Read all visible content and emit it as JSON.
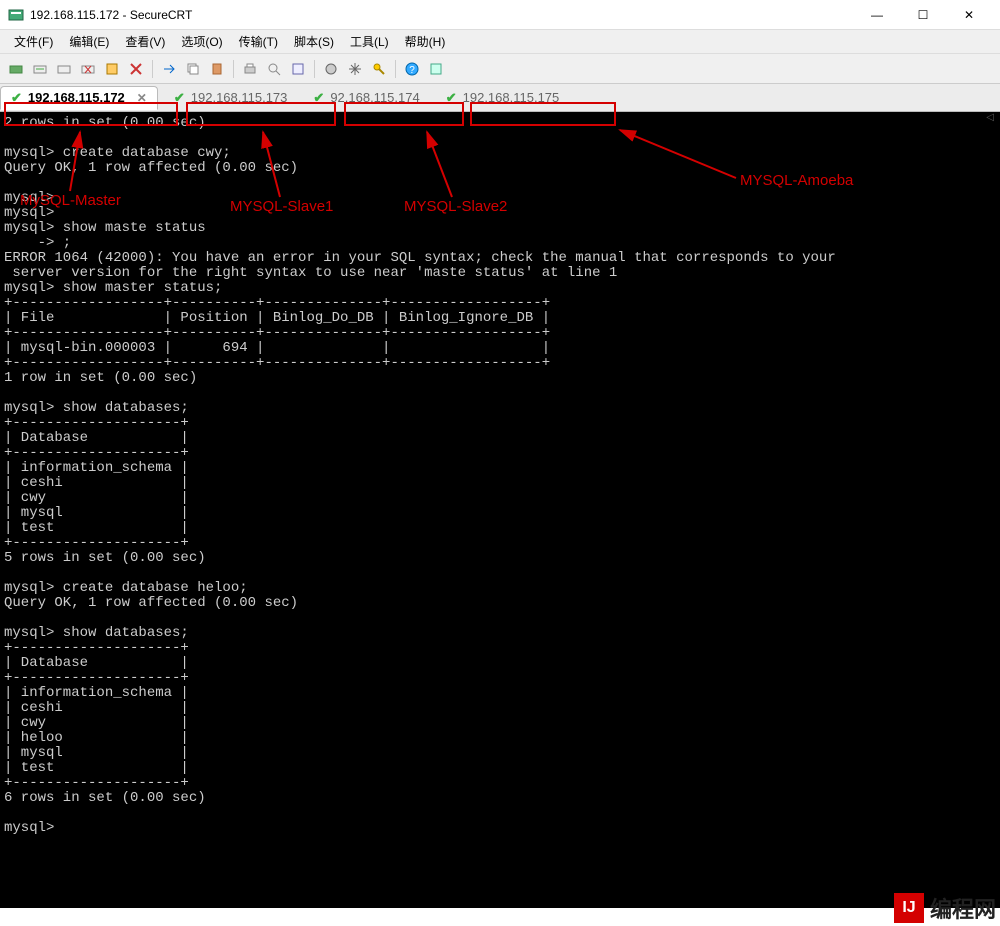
{
  "window": {
    "title": "192.168.115.172 - SecureCRT"
  },
  "menu": {
    "items": [
      "文件(F)",
      "编辑(E)",
      "查看(V)",
      "选项(O)",
      "传输(T)",
      "脚本(S)",
      "工具(L)",
      "帮助(H)"
    ]
  },
  "tabs": [
    {
      "label": "192.168.115.172",
      "active": true,
      "closeable": true
    },
    {
      "label": "192.168.115.173",
      "active": false,
      "closeable": false
    },
    {
      "label": "92.168.115.174",
      "active": false,
      "closeable": false
    },
    {
      "label": "192.168.115.175",
      "active": false,
      "closeable": false
    }
  ],
  "annotations": {
    "a1": "MySQL-Master",
    "a2": "MYSQL-Slave1",
    "a3": "MYSQL-Slave2",
    "a4": "MYSQL-Amoeba"
  },
  "terminal_lines": [
    "2 rows in set (0.00 sec)",
    "",
    "mysql> create database cwy;",
    "Query OK, 1 row affected (0.00 sec)",
    "",
    "mysql>",
    "mysql>",
    "mysql> show maste status",
    "    -> ;",
    "ERROR 1064 (42000): You have an error in your SQL syntax; check the manual that corresponds to your",
    " server version for the right syntax to use near 'maste status' at line 1",
    "mysql> show master status;",
    "+------------------+----------+--------------+------------------+",
    "| File             | Position | Binlog_Do_DB | Binlog_Ignore_DB |",
    "+------------------+----------+--------------+------------------+",
    "| mysql-bin.000003 |      694 |              |                  |",
    "+------------------+----------+--------------+------------------+",
    "1 row in set (0.00 sec)",
    "",
    "mysql> show databases;",
    "+--------------------+",
    "| Database           |",
    "+--------------------+",
    "| information_schema |",
    "| ceshi              |",
    "| cwy                |",
    "| mysql              |",
    "| test               |",
    "+--------------------+",
    "5 rows in set (0.00 sec)",
    "",
    "mysql> create database heloo;",
    "Query OK, 1 row affected (0.00 sec)",
    "",
    "mysql> show databases;",
    "+--------------------+",
    "| Database           |",
    "+--------------------+",
    "| information_schema |",
    "| ceshi              |",
    "| cwy                |",
    "| heloo              |",
    "| mysql              |",
    "| test               |",
    "+--------------------+",
    "6 rows in set (0.00 sec)",
    "",
    "mysql>"
  ],
  "watermark": {
    "logo": "IJ",
    "text": "编程网"
  },
  "icons": {
    "check": "✔",
    "close": "✕",
    "minimize": "—",
    "maximize": "☐",
    "win_close": "✕"
  }
}
